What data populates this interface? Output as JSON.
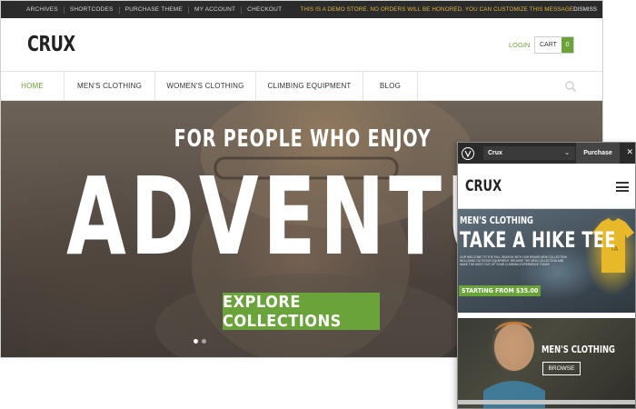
{
  "topbar": {
    "links": [
      "ARCHIVES",
      "SHORTCODES",
      "PURCHASE THEME",
      "MY ACCOUNT",
      "CHECKOUT"
    ],
    "notice": "THIS IS A DEMO STORE. NO ORDERS WILL BE HONORED. YOU CAN CUSTOMIZE THIS MESSAGE!",
    "dismiss": "DISMISS"
  },
  "header": {
    "logo": "CRUX",
    "login": "LOGIN",
    "cart_label": "CART",
    "cart_count": "0"
  },
  "nav": {
    "items": [
      "HOME",
      "MEN'S CLOTHING",
      "WOMEN'S CLOTHING",
      "CLIMBING EQUIPMENT",
      "BLOG"
    ],
    "active_index": 0
  },
  "hero": {
    "subtitle": "FOR PEOPLE WHO ENJOY",
    "headline": "ADVENTURE",
    "cta": "EXPLORE COLLECTIONS",
    "slide_count": 2,
    "active_slide": 0
  },
  "mobile": {
    "theme_select": "Crux",
    "purchase": "Purchase",
    "close": "✕",
    "logo": "CRUX",
    "card1": {
      "category": "MEN'S CLOTHING",
      "title": "TAKE A HIKE TEE",
      "description": "OUR WELCOME TO THE FALL SEASON WITH OUR BRAND NEW COLLECTION INCLUDING OUTDOOR EQUIPMENT. BROWSE THE NEW COLLECTION AND MAKE THE MOST OUT OF YOUR CLIMBING EXPERIENCE TODAY!",
      "price": "STARTING FROM $35.00"
    },
    "card2": {
      "category": "MEN'S CLOTHING",
      "button": "BROWSE"
    }
  },
  "colors": {
    "accent": "#6aa33a",
    "topbar": "#2b2b2b",
    "notice": "#e0b64a"
  },
  "icons": [
    "search-icon",
    "theme-logo-icon",
    "chevron-down-icon",
    "close-icon",
    "hamburger-menu-icon"
  ]
}
